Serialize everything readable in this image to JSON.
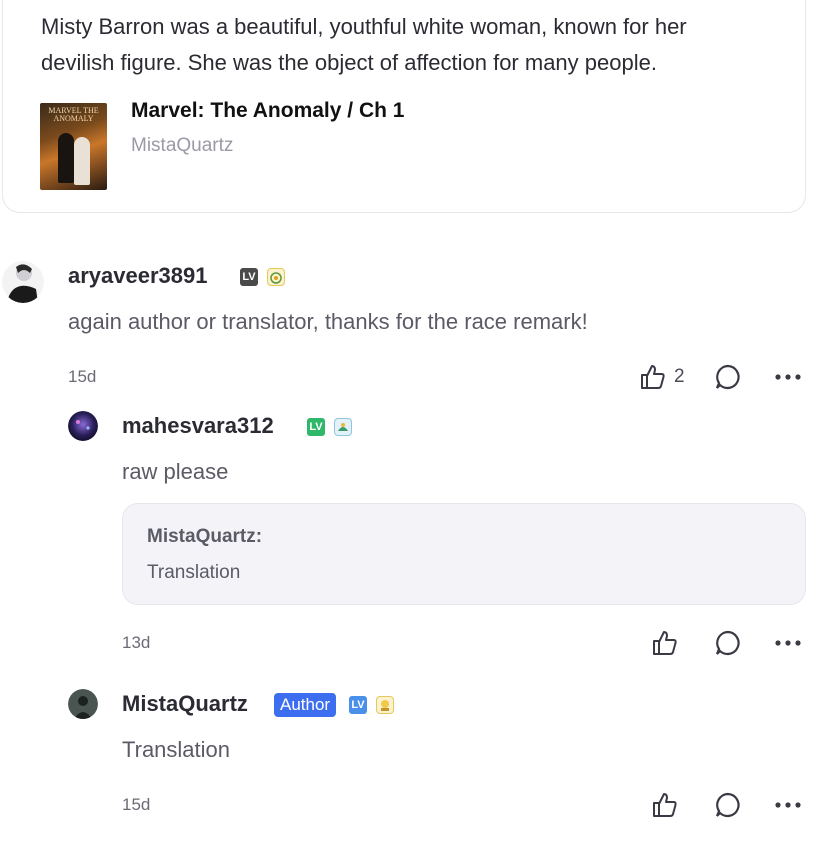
{
  "book_card": {
    "excerpt": "Misty Barron was a beautiful, youthful white woman, known for her devilish figure. She was the object of affection for many people.",
    "cover_title": "MARVEL THE ANOMALY",
    "title": "Marvel: The Anomaly / Ch 1",
    "author": "MistaQuartz"
  },
  "comments": [
    {
      "username": "aryaveer3891",
      "level_badge": "LV",
      "text": "again author or translator, thanks for the race remark!",
      "time": "15d",
      "likes": "2"
    },
    {
      "username": "mahesvara312",
      "level_badge": "LV",
      "text": "raw please",
      "quote_author": "MistaQuartz:",
      "quote_text": "Translation",
      "time": "13d"
    },
    {
      "username": "MistaQuartz",
      "author_badge": "Author",
      "level_badge": "LV",
      "text": "Translation",
      "time": "15d"
    }
  ],
  "colors": {
    "author_badge": "#3d6ef0",
    "lv_badge_1": "#4a4a4a",
    "lv_badge_2": "#2fb86a",
    "lv_badge_3": "#4a8fe8"
  },
  "icons": [
    "thumbs-up-icon",
    "comment-bubble-icon",
    "more-dots-icon"
  ]
}
